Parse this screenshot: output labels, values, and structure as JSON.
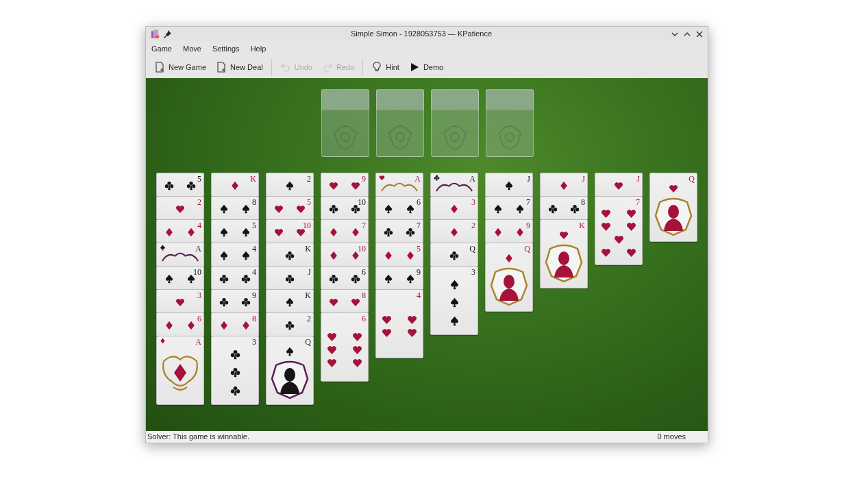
{
  "window": {
    "title": "Simple Simon - 1928053753 — KPatience"
  },
  "menu": [
    "Game",
    "Move",
    "Settings",
    "Help"
  ],
  "toolbar": [
    {
      "label": "New Game",
      "kind": "document",
      "disabled": false
    },
    {
      "label": "New Deal",
      "kind": "document",
      "disabled": false
    },
    {
      "label": "Undo",
      "kind": "undo",
      "disabled": true
    },
    {
      "label": "Redo",
      "kind": "redo",
      "disabled": true
    },
    {
      "label": "Hint",
      "kind": "hint",
      "disabled": false
    },
    {
      "label": "Demo",
      "kind": "play",
      "disabled": false
    }
  ],
  "tableau": [
    [
      {
        "rank": "5",
        "kind": "clubs"
      },
      {
        "rank": "2",
        "kind": "hearts"
      },
      {
        "rank": "4",
        "kind": "diamonds"
      },
      {
        "rank": "A",
        "kind": "spades"
      },
      {
        "rank": "10",
        "kind": "spades"
      },
      {
        "rank": "3",
        "kind": "hearts"
      },
      {
        "rank": "6",
        "kind": "diamonds"
      },
      {
        "rank": "A",
        "kind": "diamonds"
      }
    ],
    [
      {
        "rank": "K",
        "kind": "diamonds"
      },
      {
        "rank": "8",
        "kind": "spades"
      },
      {
        "rank": "5",
        "kind": "spades"
      },
      {
        "rank": "4",
        "kind": "spades"
      },
      {
        "rank": "4",
        "kind": "clubs"
      },
      {
        "rank": "9",
        "kind": "clubs"
      },
      {
        "rank": "8",
        "kind": "diamonds"
      },
      {
        "rank": "3",
        "kind": "clubs"
      }
    ],
    [
      {
        "rank": "2",
        "kind": "spades"
      },
      {
        "rank": "5",
        "kind": "hearts"
      },
      {
        "rank": "10",
        "kind": "hearts"
      },
      {
        "rank": "K",
        "kind": "clubs"
      },
      {
        "rank": "J",
        "kind": "clubs"
      },
      {
        "rank": "K",
        "kind": "spades"
      },
      {
        "rank": "2",
        "kind": "clubs"
      },
      {
        "rank": "Q",
        "kind": "spades"
      }
    ],
    [
      {
        "rank": "9",
        "kind": "hearts"
      },
      {
        "rank": "10",
        "kind": "clubs"
      },
      {
        "rank": "7",
        "kind": "diamonds"
      },
      {
        "rank": "10",
        "kind": "diamonds"
      },
      {
        "rank": "6",
        "kind": "clubs"
      },
      {
        "rank": "8",
        "kind": "hearts"
      },
      {
        "rank": "6",
        "kind": "hearts"
      }
    ],
    [
      {
        "rank": "A",
        "kind": "hearts"
      },
      {
        "rank": "6",
        "kind": "spades"
      },
      {
        "rank": "7",
        "kind": "clubs"
      },
      {
        "rank": "5",
        "kind": "diamonds"
      },
      {
        "rank": "9",
        "kind": "spades"
      },
      {
        "rank": "4",
        "kind": "hearts"
      }
    ],
    [
      {
        "rank": "A",
        "kind": "clubs"
      },
      {
        "rank": "3",
        "kind": "diamonds"
      },
      {
        "rank": "2",
        "kind": "diamonds"
      },
      {
        "rank": "Q",
        "kind": "clubs"
      },
      {
        "rank": "3",
        "kind": "spades"
      }
    ],
    [
      {
        "rank": "J",
        "kind": "spades"
      },
      {
        "rank": "7",
        "kind": "spades"
      },
      {
        "rank": "9",
        "kind": "diamonds"
      },
      {
        "rank": "Q",
        "kind": "diamonds"
      }
    ],
    [
      {
        "rank": "J",
        "kind": "diamonds"
      },
      {
        "rank": "8",
        "kind": "clubs"
      },
      {
        "rank": "K",
        "kind": "hearts"
      }
    ],
    [
      {
        "rank": "J",
        "kind": "hearts"
      },
      {
        "rank": "7",
        "kind": "hearts"
      }
    ],
    [
      {
        "rank": "Q",
        "kind": "hearts"
      }
    ]
  ],
  "status_bar": {
    "message": "Solver: This game is winnable.",
    "moves": "0 moves"
  }
}
